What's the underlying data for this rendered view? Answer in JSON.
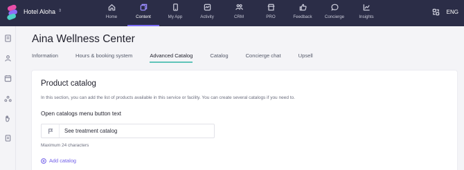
{
  "app": {
    "hotel_name": "Hotel Aloha"
  },
  "nav": {
    "items": [
      {
        "label": "Home",
        "icon": "home-icon"
      },
      {
        "label": "Content",
        "icon": "content-icon"
      },
      {
        "label": "My App",
        "icon": "phone-icon"
      },
      {
        "label": "Activity",
        "icon": "activity-icon"
      },
      {
        "label": "CRM",
        "icon": "users-icon"
      },
      {
        "label": "PRO",
        "icon": "shop-icon"
      },
      {
        "label": "Feedback",
        "icon": "thumbs-up-icon"
      },
      {
        "label": "Concierge",
        "icon": "chat-icon"
      },
      {
        "label": "Insights",
        "icon": "chart-icon"
      }
    ],
    "active": "Content",
    "language": "ENG",
    "accent_color": "#7b6cf6",
    "bar_color": "#2b2d47"
  },
  "page": {
    "title": "Aina Wellness Center",
    "tabs": [
      "Information",
      "Hours & booking system",
      "Advanced Catalog",
      "Catalog",
      "Concierge chat",
      "Upsell"
    ],
    "active_tab": "Advanced Catalog",
    "tab_underline_color": "#5fc3b8"
  },
  "card": {
    "title": "Product catalog",
    "description": "In this section, you can add the list of products available in this service or facility. You can create several catalogs if you need to.",
    "subheading": "Open catalogs menu button text",
    "input_value": "See treatment catalog",
    "hint": "Maximum 24 characters",
    "add_label": "Add catalog",
    "link_color": "#6f5de8"
  }
}
